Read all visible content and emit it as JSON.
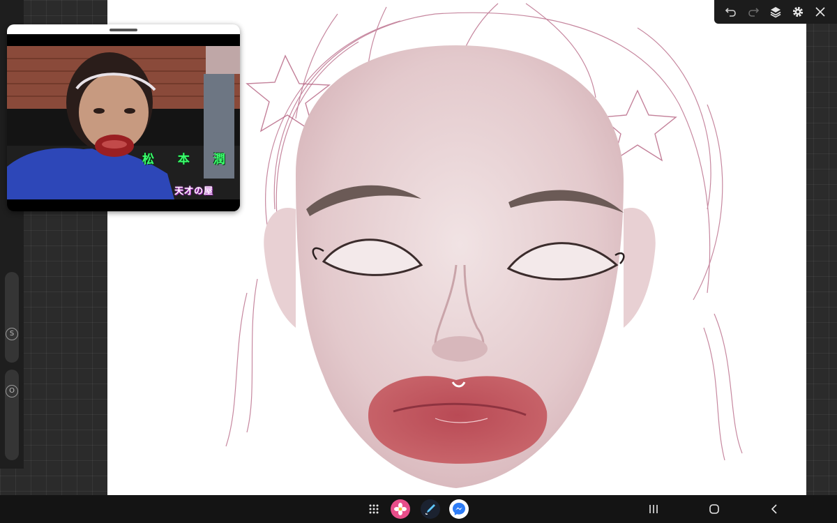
{
  "video": {
    "caption_name": "松 本 潤",
    "caption_show": "天才の屋"
  },
  "left_toolbar": {
    "size_slider_label": "S",
    "opacity_slider_label": "O"
  },
  "top_toolbar": {
    "buttons": [
      "undo-icon",
      "redo-icon",
      "layers-icon",
      "settings-icon",
      "close-icon"
    ]
  },
  "taskbar": {
    "apps": [
      "app-grid-icon",
      "gallery-icon",
      "drawing-app-icon",
      "messenger-icon"
    ],
    "nav": [
      "recents-icon",
      "home-icon",
      "back-icon"
    ]
  },
  "colors": {
    "canvas": "#ffffff",
    "sketch_line": "#b4607f",
    "skin_shade": "#ead5d7",
    "lip_fill": "#c35b60",
    "video_shirt": "#2d47b8"
  }
}
